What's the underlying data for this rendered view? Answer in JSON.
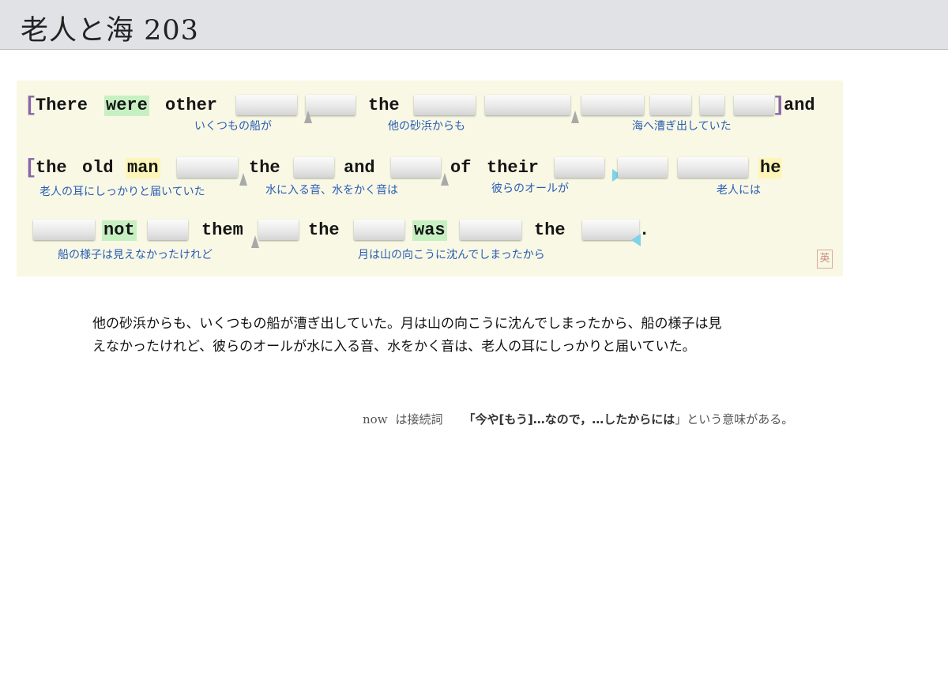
{
  "app": {
    "title": "老人と海 203"
  },
  "sentence": {
    "row1": {
      "open_bracket": "[",
      "w_there": "There",
      "w_were": "were",
      "w_other": "other",
      "w_the": "the",
      "close_bracket": "]",
      "w_and": "and",
      "gloss1": "いくつもの船が",
      "gloss2": "他の砂浜からも",
      "gloss3": "海へ漕ぎ出していた"
    },
    "row2": {
      "open_bracket": "[",
      "w_the": "the",
      "w_old": "old",
      "w_man": "man",
      "w_the2": "the",
      "w_and": "and",
      "w_of": "of",
      "w_their": "their",
      "w_he": "he",
      "gloss1": "老人の耳にしっかりと届いていた",
      "gloss2": "水に入る音、水をかく音は",
      "gloss3": "彼らのオールが",
      "gloss4": "老人には"
    },
    "row3": {
      "w_not": "not",
      "w_them": "them",
      "w_the": "the",
      "w_was": "was",
      "w_the2": "the",
      "period": ".",
      "gloss1": "船の様子は見えなかったけれど",
      "gloss2": "月は山の向こうに沈んでしまったから"
    }
  },
  "seal_char": "英",
  "translation": {
    "line1": "他の砂浜からも、いくつもの船が漕ぎ出していた。月は山の向こうに沈んでしまったから、船の様子は見",
    "line2": "えなかったけれど、彼らのオールが水に入る音、水をかく音は、老人の耳にしっかりと届いていた。"
  },
  "note": {
    "keyword": "now",
    "text1": "は接続詞",
    "emphasis": "「今や[もう]…なので，…したからには",
    "text2": "」という意味がある。"
  },
  "colors": {
    "panel_bg": "#f8f8e5",
    "highlight_green": "#c7f0c2",
    "highlight_yellow": "#fdf6b8",
    "gloss_blue": "#2a5db4",
    "bracket_purple": "#8a64a8"
  }
}
